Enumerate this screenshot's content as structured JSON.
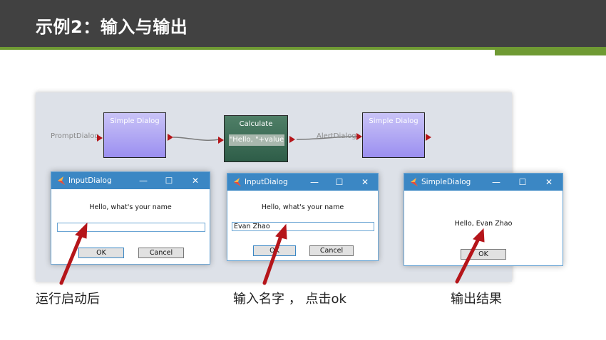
{
  "slide": {
    "title": "示例2：输入与输出",
    "accent_color": "#6f9a33",
    "header_color": "#414141"
  },
  "flow": {
    "nodes": [
      {
        "label": "Simple Dialog"
      },
      {
        "label": "Calculate",
        "expression": "\"Hello, \"+value"
      },
      {
        "label": "Simple Dialog"
      }
    ],
    "edges": [
      {
        "label": "PromptDialog"
      },
      {
        "label": "AlertDialog"
      }
    ]
  },
  "dialogs": [
    {
      "title": "InputDialog",
      "message": "Hello, what's your name",
      "input_value": "",
      "ok_label": "OK",
      "cancel_label": "Cancel"
    },
    {
      "title": "InputDialog",
      "message": "Hello, what's your name",
      "input_value": "Evan Zhao",
      "ok_label": "OK",
      "cancel_label": "Cancel"
    },
    {
      "title": "SimpleDialog",
      "message": "Hello, Evan Zhao",
      "ok_label": "OK"
    }
  ],
  "window_controls": {
    "minimize": "—",
    "maximize": "☐",
    "close": "✕"
  },
  "captions": [
    "运行启动后",
    "输入名字 ，  点击ok",
    "输出结果"
  ],
  "arrow_color": "#b5151a"
}
